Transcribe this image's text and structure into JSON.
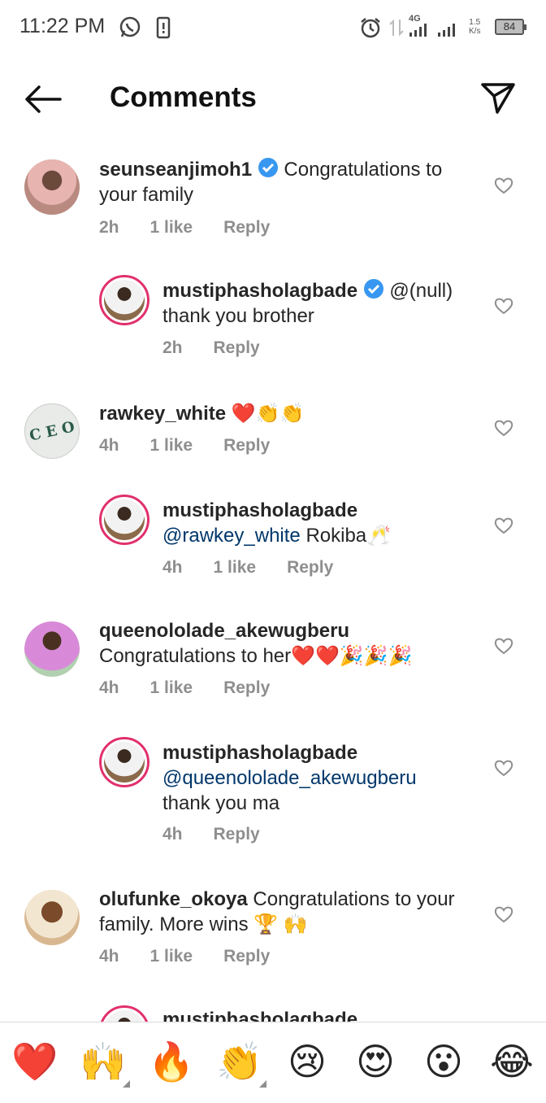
{
  "status_bar": {
    "time": "11:22 PM",
    "network": "4G",
    "speed_value": "1.5",
    "speed_unit": "K/s",
    "battery": "84"
  },
  "header": {
    "title": "Comments"
  },
  "comments": [
    {
      "username": "seunseanjimoh1",
      "verified": true,
      "text": "Congratulations to your family",
      "time": "2h",
      "likes": "1 like",
      "reply": "Reply",
      "avatar_color": "#a86e6e"
    },
    {
      "username": "mustiphasholagbade",
      "verified": true,
      "mention": "",
      "text": "@(null) thank you brother",
      "time": "2h",
      "reply": "Reply",
      "avatar_color": "#8a6a4a"
    },
    {
      "username": "rawkey_white",
      "text": "❤️👏👏",
      "time": "4h",
      "likes": "1 like",
      "reply": "Reply",
      "avatar_letters": "C E O"
    },
    {
      "username": "mustiphasholagbade",
      "mention": "@rawkey_white",
      "text": "Rokiba🥂",
      "time": "4h",
      "likes": "1 like",
      "reply": "Reply",
      "avatar_color": "#8a6a4a"
    },
    {
      "username": "queenololade_akewugberu",
      "text": "Congratulations to her❤️❤️🎉🎉🎉",
      "time": "4h",
      "likes": "1 like",
      "reply": "Reply",
      "avatar_color": "#c98ac9"
    },
    {
      "username": "mustiphasholagbade",
      "mention": "@queenololade_akewugberu",
      "text": "thank you ma",
      "time": "4h",
      "reply": "Reply",
      "avatar_color": "#8a6a4a"
    },
    {
      "username": "olufunke_okoya",
      "text": "Congratulations to your family. More wins 🏆 🙌",
      "time": "4h",
      "likes": "1 like",
      "reply": "Reply",
      "avatar_color": "#b08a5a"
    }
  ],
  "partial_comment": {
    "username": "mustiphasholagbade"
  },
  "reactions": [
    {
      "emoji": "❤️",
      "name": "heart"
    },
    {
      "emoji": "🙌",
      "name": "raising-hands"
    },
    {
      "emoji": "🔥",
      "name": "fire"
    },
    {
      "emoji": "👏",
      "name": "clapping"
    },
    {
      "emoji": "😢",
      "name": "crying"
    },
    {
      "emoji": "😍",
      "name": "heart-eyes"
    },
    {
      "emoji": "😮",
      "name": "surprised"
    },
    {
      "emoji": "😂",
      "name": "laughing"
    }
  ],
  "colors": {
    "accent_ring": "#e1306c",
    "verified": "#3897f0",
    "mention": "#00376b",
    "meta": "#8e8e8e"
  }
}
